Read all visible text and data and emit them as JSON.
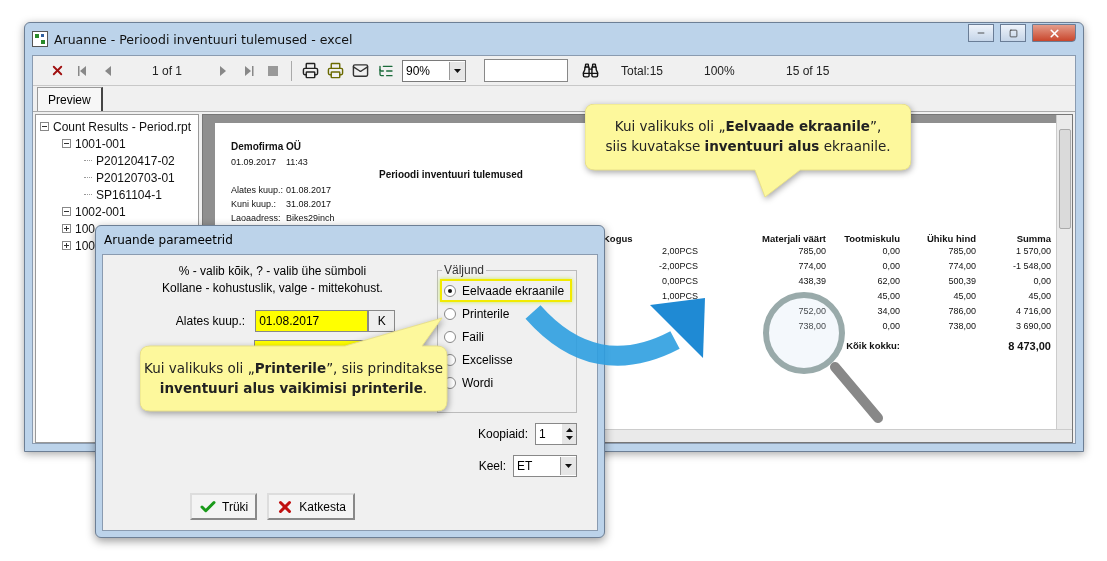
{
  "window": {
    "title": "Aruanne - Perioodi inventuuri tulemused - excel"
  },
  "toolbar": {
    "page": "1 of 1",
    "zoom": "90%",
    "total": "Total:15",
    "percent": "100%",
    "count": "15 of 15"
  },
  "tabs": [
    {
      "label": "Preview",
      "selected": true
    }
  ],
  "tree": [
    {
      "label": "Count Results - Period.rpt",
      "expanded": true,
      "children": [
        {
          "label": "1001-001",
          "expanded": true,
          "children": [
            {
              "label": "P20120417-02"
            },
            {
              "label": "P20120703-01"
            },
            {
              "label": "SP161104-1"
            }
          ]
        },
        {
          "label": "1002-001",
          "expanded": true
        },
        {
          "label": "100",
          "expanded": false
        },
        {
          "label": "100",
          "expanded": false
        }
      ]
    }
  ],
  "report": {
    "company": "Demofirma OÜ",
    "date": "01.09.2017",
    "time": "11:43",
    "title": "Perioodi inventuuri tulemused",
    "fields": [
      {
        "label": "Alates kuup.:",
        "value": "01.08.2017"
      },
      {
        "label": "Kuni kuup.:",
        "value": "31.08.2017"
      },
      {
        "label": "Laoaadress:",
        "value": "Bikes29inch"
      }
    ],
    "columns": [
      "Kogus",
      "Materjali väärt",
      "Tootmiskulu",
      "Ühiku hind",
      "Summa"
    ],
    "rows": [
      [
        "2,00PCS",
        "785,00",
        "0,00",
        "785,00",
        "1 570,00"
      ],
      [
        "-2,00PCS",
        "774,00",
        "0,00",
        "774,00",
        "-1 548,00"
      ],
      [
        "0,00PCS",
        "438,39",
        "62,00",
        "500,39",
        "0,00"
      ],
      [
        "1,00PCS",
        null,
        "45,00",
        "45,00",
        "45,00"
      ],
      [
        null,
        "752,00",
        "34,00",
        "786,00",
        "4 716,00"
      ],
      [
        null,
        "738,00",
        "0,00",
        "738,00",
        "3 690,00"
      ]
    ],
    "total_label": "Kõik kokku:",
    "total": "8 473,00"
  },
  "dialog": {
    "title": "Aruande parameetrid",
    "hints": [
      "% - valib kõik, ? - valib ühe sümboli",
      "Kollane - kohustuslik, valge - mittekohust."
    ],
    "date_from": {
      "label": "Alates kuup.:",
      "value": "01.08.2017",
      "button": "K"
    },
    "output": {
      "label": "Väljund",
      "options": [
        {
          "label": "Eelvaade ekraanile",
          "selected": true,
          "highlighted": true
        },
        {
          "label": "Printerile",
          "selected": false,
          "highlighted": false
        },
        {
          "label": "Faili",
          "selected": false,
          "highlighted": false
        },
        {
          "label": "Excelisse",
          "selected": false,
          "highlighted": false
        },
        {
          "label": "Wordi",
          "selected": false,
          "highlighted": false
        }
      ]
    },
    "copies": {
      "label": "Koopiaid:",
      "value": "1"
    },
    "language": {
      "label": "Keel:",
      "value": "ET"
    },
    "buttons": [
      {
        "label": "Trüki",
        "kind": "ok"
      },
      {
        "label": "Katkesta",
        "kind": "cancel"
      }
    ]
  },
  "callouts": [
    {
      "text": "Kui valikuks oli „**Eelvaade ekraanile**”,\nsiis kuvatakse **inventuuri alus** ekraanile."
    },
    {
      "text": "Kui valikuks oli „**Printerile**”, siis prinditakse\n**inventuuri alus vaikimisi printerile**."
    }
  ]
}
